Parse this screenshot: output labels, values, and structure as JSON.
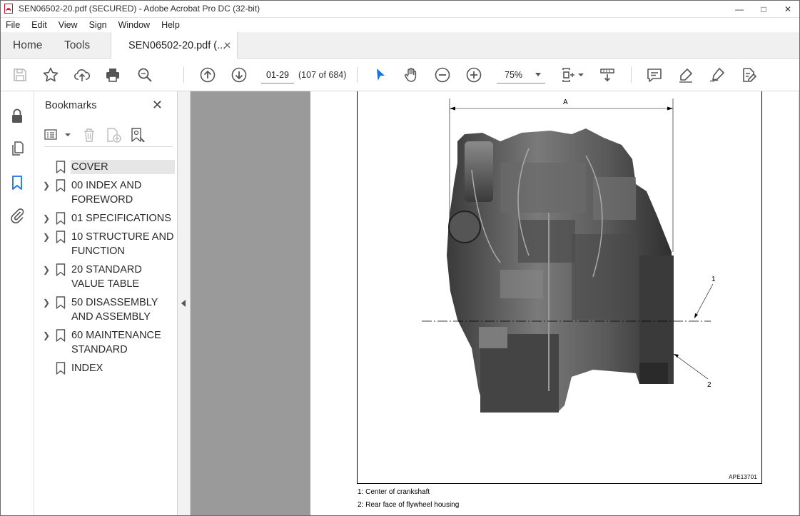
{
  "window": {
    "title": "SEN06502-20.pdf (SECURED) - Adobe Acrobat Pro DC (32-bit)"
  },
  "menu": [
    "File",
    "Edit",
    "View",
    "Sign",
    "Window",
    "Help"
  ],
  "tabs": {
    "home": "Home",
    "tools": "Tools",
    "document": "SEN06502-20.pdf (..."
  },
  "toolbar": {
    "page_input": "01-29",
    "page_count": "(107 of 684)",
    "zoom": "75%",
    "icons": [
      "save-icon",
      "star-icon",
      "upload-icon",
      "print-icon",
      "search-icon",
      "prev-page-icon",
      "next-page-icon",
      "select-cursor-icon",
      "hand-icon",
      "zoom-out-icon",
      "zoom-in-icon",
      "fit-page-icon",
      "scroll-mode-icon",
      "comment-icon",
      "highlight-icon",
      "sign-icon",
      "edit-pdf-icon"
    ],
    "accent": "#1473e6"
  },
  "bookmarks": {
    "title": "Bookmarks",
    "items": [
      {
        "label": "COVER",
        "expandable": false,
        "selected": true
      },
      {
        "label": " 00 INDEX AND FOREWORD",
        "expandable": true
      },
      {
        "label": " 01 SPECIFICATIONS",
        "expandable": true
      },
      {
        "label": " 10 STRUCTURE AND FUNCTION",
        "expandable": true
      },
      {
        "label": " 20 STANDARD VALUE TABLE",
        "expandable": true
      },
      {
        "label": " 50 DISASSEMBLY AND ASSEMBLY",
        "expandable": true
      },
      {
        "label": " 60 MAINTENANCE STANDARD",
        "expandable": true
      },
      {
        "label": "INDEX",
        "expandable": false
      }
    ]
  },
  "document": {
    "dimension_label": "A",
    "callout_1": "1",
    "callout_2": "2",
    "figure_id": "APE13701",
    "captions": [
      "1: Center of crankshaft",
      "2: Rear face of flywheel housing"
    ]
  }
}
